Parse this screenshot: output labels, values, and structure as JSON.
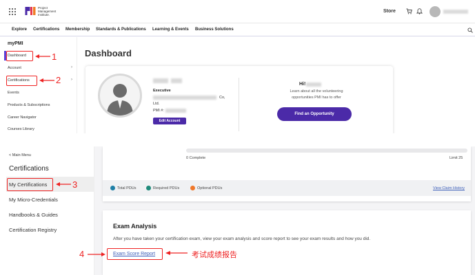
{
  "header": {
    "logo_line1": "Project",
    "logo_line2": "Management",
    "logo_line3": "Institute.",
    "store_label": "Store",
    "icons": [
      "apps-grid-icon",
      "cart-icon",
      "bell-icon"
    ]
  },
  "nav": {
    "items": [
      "Explore",
      "Certifications",
      "Membership",
      "Standards & Publications",
      "Learning & Events",
      "Business Solutions"
    ]
  },
  "sidebar": {
    "title": "myPMI",
    "items": [
      "Dashboard",
      "Account",
      "Certifications",
      "Events",
      "Products & Subscriptions",
      "Career Navigator",
      "Courses Library"
    ]
  },
  "dashboard": {
    "title": "Dashboard",
    "role": "Executive",
    "company_suffix": "Co,",
    "ltd": "Ltd.",
    "pmi_label": "PMI #:",
    "edit_button": "Edit Account",
    "greeting": "Hi!",
    "volunteer_text": "Learn about all the volunteering opportunities PMI has to offer",
    "opportunity_button": "Find an Opportunity"
  },
  "cert_sidebar": {
    "back": "< Main Menu",
    "title": "Certifications",
    "items": [
      "My Certifications",
      "My Micro-Credentials",
      "Handbooks & Guides",
      "Certification Registry"
    ]
  },
  "pdu": {
    "progress_start": "0 Complete",
    "progress_end": "Limit 25",
    "progress_fraction": 0,
    "legend": [
      "Total PDUs",
      "Required PDUs",
      "Optional PDUs"
    ],
    "legend_colors": [
      "#1f7fa6",
      "#1f8a7a",
      "#f0782a"
    ],
    "claim_history": "View Claim History"
  },
  "exam": {
    "title": "Exam Analysis",
    "description": "After you have taken your certification exam, view your exam analysis and score report to see your exam results and how you did.",
    "report_link": "Exam Score Report"
  },
  "annotations": {
    "n1": "1",
    "n2": "2",
    "n3": "3",
    "n4": "4",
    "chinese_note": "考试成绩报告",
    "color": "#e22222"
  }
}
